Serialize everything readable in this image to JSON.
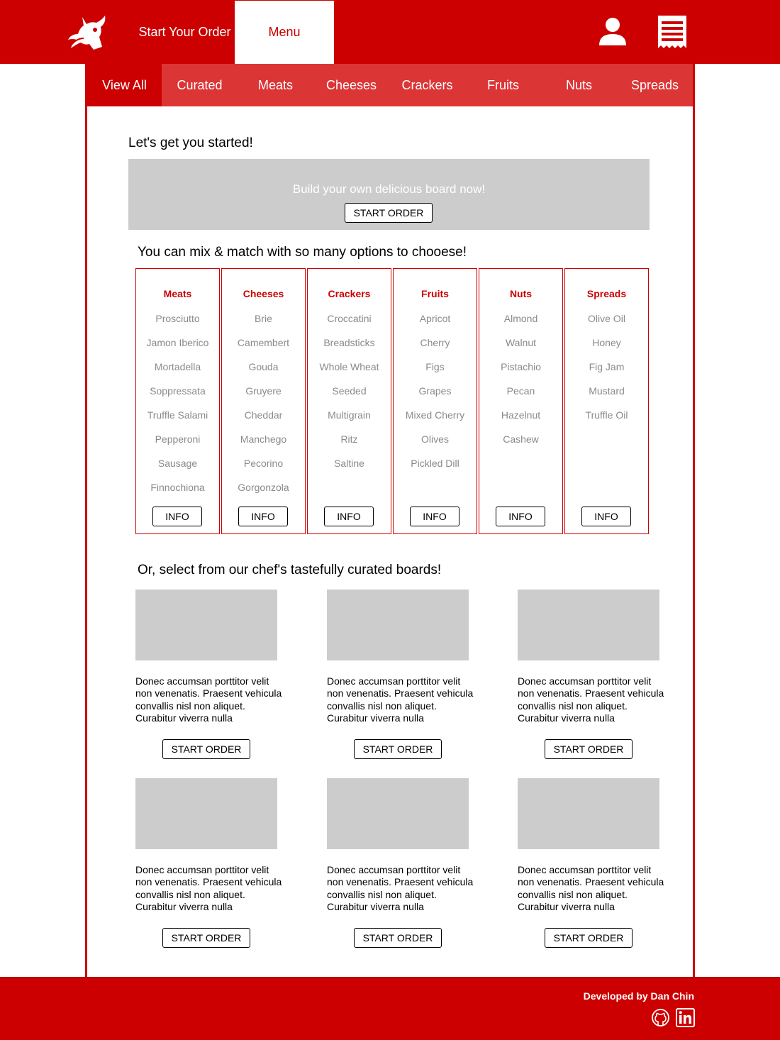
{
  "header": {
    "logo": "bull-logo-icon",
    "nav_start": "Start Your Order",
    "nav_menu": "Menu",
    "user_icon": "user-icon",
    "receipt_icon": "receipt-icon"
  },
  "tabs": [
    {
      "label": "View All",
      "active": true
    },
    {
      "label": "Curated"
    },
    {
      "label": "Meats"
    },
    {
      "label": "Cheeses"
    },
    {
      "label": "Crackers"
    },
    {
      "label": "Fruits"
    },
    {
      "label": "Nuts"
    },
    {
      "label": "Spreads"
    }
  ],
  "intro": {
    "heading": "Let's get you started!",
    "banner_text": "Build your own delicious board now!",
    "banner_button": "START ORDER"
  },
  "mix": {
    "heading": "You can mix & match with so many options to chooese!",
    "button": "INFO",
    "columns": [
      {
        "title": "Meats",
        "items": [
          "Prosciutto",
          "Jamon Iberico",
          "Mortadella",
          "Soppressata",
          "Truffle Salami",
          "Pepperoni",
          "Sausage",
          "Finnochiona"
        ]
      },
      {
        "title": "Cheeses",
        "items": [
          "Brie",
          "Camembert",
          "Gouda",
          "Gruyere",
          "Cheddar",
          "Manchego",
          "Pecorino",
          "Gorgonzola"
        ]
      },
      {
        "title": "Crackers",
        "items": [
          "Croccatini",
          "Breadsticks",
          "Whole Wheat",
          "Seeded",
          "Multigrain",
          "Ritz",
          "Saltine"
        ]
      },
      {
        "title": "Fruits",
        "items": [
          "Apricot",
          "Cherry",
          "Figs",
          "Grapes",
          "Mixed Cherry",
          "Olives",
          "Pickled Dill"
        ]
      },
      {
        "title": "Nuts",
        "items": [
          "Almond",
          "Walnut",
          "Pistachio",
          "Pecan",
          "Hazelnut",
          "Cashew"
        ]
      },
      {
        "title": "Spreads",
        "items": [
          "Olive Oil",
          "Honey",
          "Fig Jam",
          "Mustard",
          "Truffle Oil"
        ]
      }
    ]
  },
  "curated": {
    "heading": "Or, select from our chef's tastefully curated boards!",
    "boards": [
      {
        "desc": "Donec accumsan porttitor velit non venenatis. Praesent vehicula convallis nisl non aliquet. Curabitur viverra nulla",
        "button": "START ORDER"
      },
      {
        "desc": "Donec accumsan porttitor velit non venenatis. Praesent vehicula convallis nisl non aliquet. Curabitur viverra nulla",
        "button": "START ORDER"
      },
      {
        "desc": "Donec accumsan porttitor velit non venenatis. Praesent vehicula convallis nisl non aliquet. Curabitur viverra nulla",
        "button": "START ORDER"
      },
      {
        "desc": "Donec accumsan porttitor velit non venenatis. Praesent vehicula convallis nisl non aliquet. Curabitur viverra nulla",
        "button": "START ORDER"
      },
      {
        "desc": "Donec accumsan porttitor velit non venenatis. Praesent vehicula convallis nisl non aliquet. Curabitur viverra nulla",
        "button": "START ORDER"
      },
      {
        "desc": "Donec accumsan porttitor velit non venenatis. Praesent vehicula convallis nisl non aliquet. Curabitur viverra nulla",
        "button": "START ORDER"
      }
    ]
  },
  "footer": {
    "credit": "Developed by Dan Chin",
    "github_icon": "github-icon",
    "linkedin_icon": "linkedin-icon"
  },
  "colors": {
    "brand_red": "#cc0000",
    "tab_red": "#dc3535",
    "placeholder_gray": "#cccccc",
    "list_gray": "#8a8a8a"
  }
}
